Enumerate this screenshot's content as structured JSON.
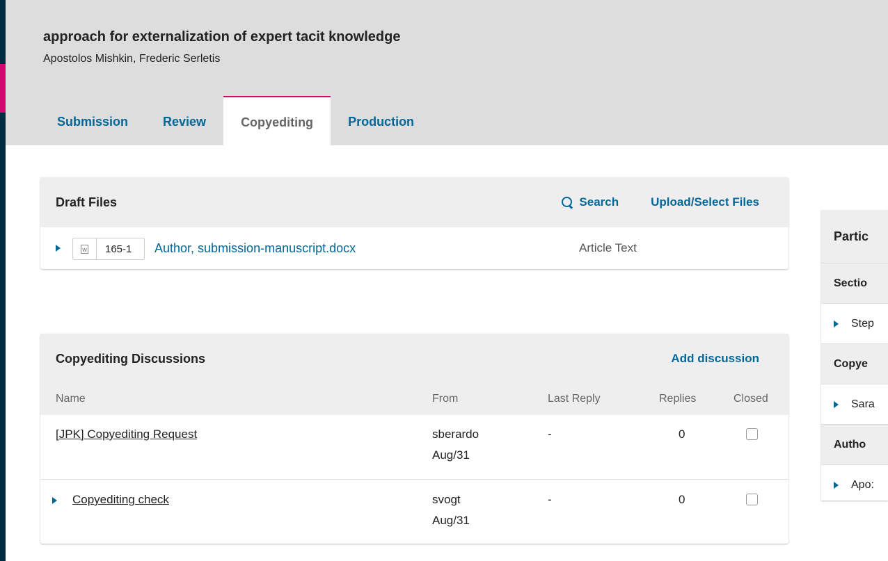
{
  "submission": {
    "title": "approach for externalization of expert tacit knowledge",
    "authors": "Apostolos Mishkin, Frederic Serletis"
  },
  "tabs": [
    {
      "label": "Submission",
      "active": false
    },
    {
      "label": "Review",
      "active": false
    },
    {
      "label": "Copyediting",
      "active": true
    },
    {
      "label": "Production",
      "active": false
    }
  ],
  "draft_files": {
    "title": "Draft Files",
    "search_label": "Search",
    "upload_label": "Upload/Select Files",
    "files": [
      {
        "id": "165-1",
        "name": "Author, submission-manuscript.docx",
        "type": "Article Text",
        "icon": "word-document-icon"
      }
    ]
  },
  "discussions": {
    "title": "Copyediting Discussions",
    "add_label": "Add discussion",
    "columns": {
      "name": "Name",
      "from": "From",
      "last_reply": "Last Reply",
      "replies": "Replies",
      "closed": "Closed"
    },
    "rows": [
      {
        "name": "[JPK] Copyediting Request",
        "from_user": "sberardo",
        "from_date": "Aug/31",
        "last_reply": "-",
        "replies": "0",
        "closed": false
      },
      {
        "name": "Copyediting check",
        "from_user": "svogt",
        "from_date": "Aug/31",
        "last_reply": "-",
        "replies": "0",
        "closed": false
      }
    ]
  },
  "participants": {
    "title": "Partic",
    "groups": [
      {
        "label": "Sectio",
        "member": "Step"
      },
      {
        "label": "Copye",
        "member": "Sara"
      },
      {
        "label": "Autho",
        "member": "Apo:"
      }
    ]
  },
  "colors": {
    "accent": "#d00a6c",
    "link": "#006798",
    "rail": "#002c40"
  }
}
